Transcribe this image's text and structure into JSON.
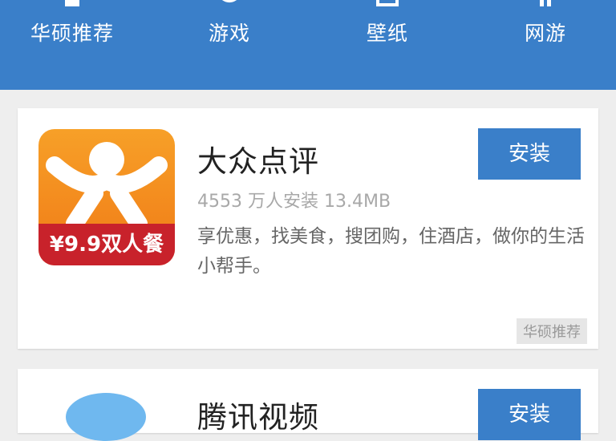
{
  "nav": {
    "items": [
      {
        "label": "华硕推荐",
        "icon": "recommend-icon"
      },
      {
        "label": "游戏",
        "icon": "game-icon"
      },
      {
        "label": "壁纸",
        "icon": "wallpaper-icon"
      },
      {
        "label": "网游",
        "icon": "online-game-icon"
      }
    ]
  },
  "apps": [
    {
      "name": "大众点评",
      "meta": "4553 万人安装  13.4MB",
      "description": "享优惠，找美食，搜团购，住酒店，做你的生活小帮手。",
      "install_label": "安装",
      "tag": "华硕推荐",
      "icon_badge": "¥9.9双人餐"
    },
    {
      "name": "腾讯视频",
      "install_label": "安装"
    }
  ],
  "colors": {
    "accent": "#3a7fc9",
    "icon_orange": "#f28a1e",
    "badge_red": "#c8222b"
  }
}
